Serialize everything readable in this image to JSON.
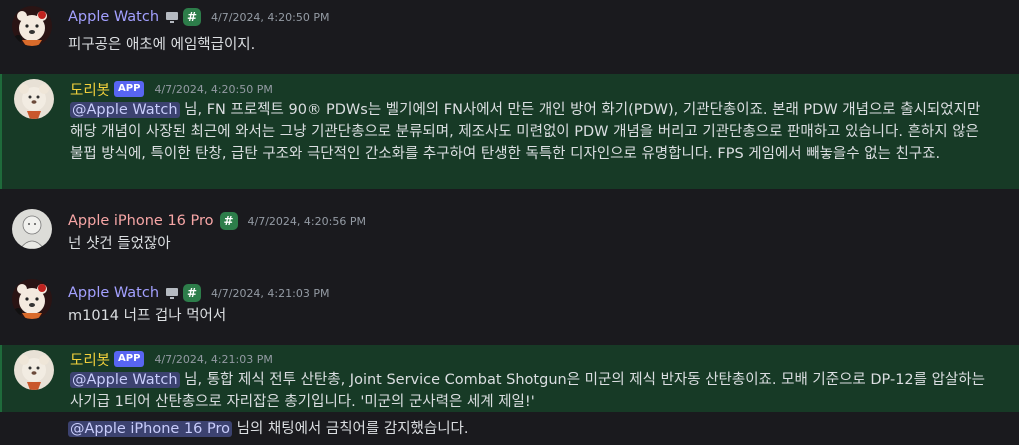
{
  "messages": [
    {
      "author": "Apple Watch",
      "author_color": "#a3a0ff",
      "has_monitor_icon": true,
      "badge_hash": "#",
      "timestamp": "4/7/2024, 4:20:50 PM",
      "text": "피구공은 애초에 에임핵급이지."
    },
    {
      "author": "도리봇",
      "author_color": "#f3d13c",
      "app_badge": "APP",
      "timestamp": "4/7/2024, 4:20:50 PM",
      "mention": "@Apple Watch",
      "text": " 님, FN 프로젝트 90® PDWs는 벨기에의 FN사에서 만든 개인 방어 화기(PDW), 기관단총이죠. 본래 PDW 개념으로 출시되었지만 해당 개념이 사장된 최근에 와서는 그냥 기관단총으로 분류되며, 제조사도 미련없이 PDW 개념을 버리고 기관단총으로 판매하고 있습니다. 흔하지 않은 불펍 방식에, 특이한 탄창, 급탄 구조와 극단적인 간소화를 추구하여 탄생한 독특한 디자인으로 유명합니다. FPS 게임에서 빼놓을수 없는 친구죠."
    },
    {
      "author": "Apple iPhone 16 Pro",
      "author_color": "#f7a6a6",
      "badge_hash": "#",
      "timestamp": "4/7/2024, 4:20:56 PM",
      "text": "넌 샷건 들었잖아"
    },
    {
      "author": "Apple Watch",
      "author_color": "#a3a0ff",
      "has_monitor_icon": true,
      "badge_hash": "#",
      "timestamp": "4/7/2024, 4:21:03 PM",
      "text": "m1014 너프 겁나 먹어서"
    },
    {
      "author": "도리봇",
      "author_color": "#f3d13c",
      "app_badge": "APP",
      "timestamp": "4/7/2024, 4:21:03 PM",
      "mention": "@Apple Watch",
      "text": " 님, 통합 제식 전투 산탄총, Joint Service Combat Shotgun은 미군의 제식 반자동 산탄총이죠. 모배 기준으로 DP-12를 압살하는 사기급 1티어 산탄총으로 자리잡은 총기입니다. '미군의 군사력은 세계 제일!'",
      "followup_mention": "@Apple iPhone 16 Pro",
      "followup_text": " 님의 채팅에서 금칙어를 감지했습니다."
    }
  ]
}
